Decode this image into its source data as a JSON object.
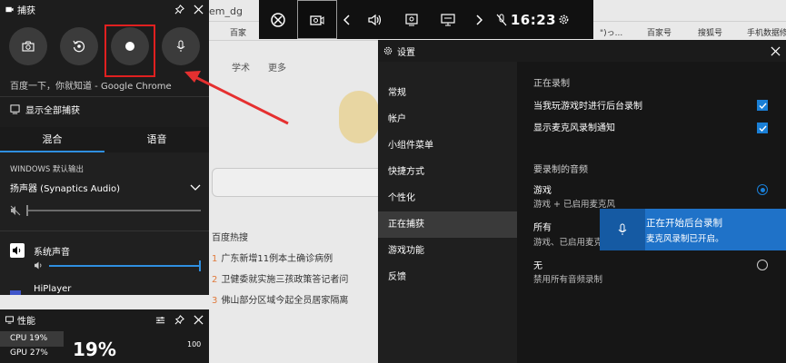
{
  "background_page": {
    "tab_fragment": "em_dg",
    "bookmarks": [
      "百家",
      "\")っ...",
      "百家号",
      "搜狐号",
      "手机数据修"
    ],
    "links": [
      "学术",
      "更多"
    ],
    "hot_title": "百度热搜",
    "news": [
      {
        "rank": "1",
        "text": "广东新增11例本土确诊病例"
      },
      {
        "rank": "2",
        "text": "卫健委就实施三孩政策答记者问"
      },
      {
        "rank": "3",
        "text": "佛山部分区域今起全员居家隔离"
      }
    ]
  },
  "gamebar": {
    "clock": "16:23"
  },
  "capture": {
    "title": "捕获",
    "status_text": "百度一下，你就知道 - Google Chrome",
    "show_all": "显示全部捕获"
  },
  "audio": {
    "tabs": [
      "混合",
      "语音"
    ],
    "output_label": "WINDOWS 默认输出",
    "device": "扬声器 (Synaptics Audio)",
    "apps": [
      {
        "name": "系统声音"
      },
      {
        "name": "HiPlayer"
      }
    ],
    "master_level": 0.0,
    "system_level": 1.0
  },
  "performance": {
    "title": "性能",
    "cpu_label": "CPU 19%",
    "gpu_label": "GPU 27%",
    "big_value": "19%",
    "max_value": "100"
  },
  "settings": {
    "title": "设置",
    "nav": [
      "常规",
      "帐户",
      "小组件菜单",
      "快捷方式",
      "个性化",
      "正在捕获",
      "游戏功能",
      "反馈"
    ],
    "active_nav": "正在捕获",
    "section_recording": "正在录制",
    "opt_background": "当我玩游戏时进行后台录制",
    "opt_mic_notify": "显示麦克风录制通知",
    "section_audio": "要录制的音频",
    "audio_options": [
      {
        "label": "游戏",
        "desc": "游戏 + 已启用麦克风",
        "selected": true
      },
      {
        "label": "所有",
        "desc": "游戏、已启用麦克",
        "selected": false
      },
      {
        "label": "无",
        "desc": "禁用所有音频录制",
        "selected": false
      }
    ]
  },
  "toast": {
    "title": "正在开始后台录制",
    "subtitle": "麦克风录制已开启。"
  },
  "colors": {
    "accent": "#1a7fd6",
    "record_box": "#e02020",
    "toast": "#1f72c8"
  }
}
